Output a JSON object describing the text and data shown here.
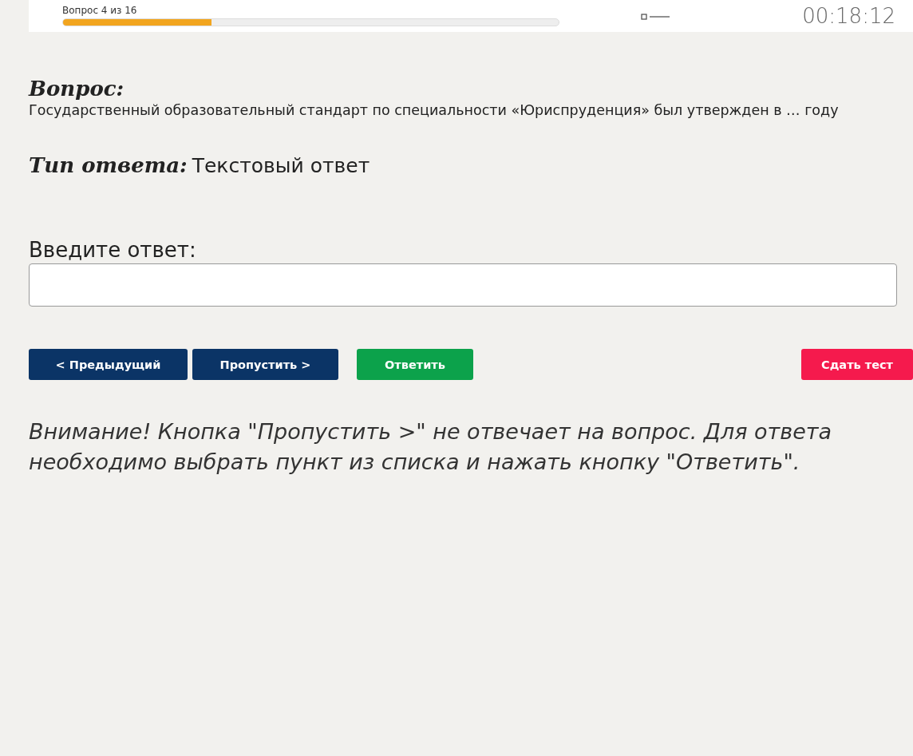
{
  "header": {
    "progress_text": "Вопрос 4 из 16",
    "progress": {
      "level": 0.3
    },
    "timer": "00:18:12"
  },
  "question": {
    "heading": "Вопрос:",
    "text": "Государственный образовательный стандарт по специальности «Юриспруденция» был утвержден в … году"
  },
  "answer_type": {
    "heading": "Тип ответа:",
    "value": "Текстовый ответ"
  },
  "answer": {
    "label": "Введите ответ:"
  },
  "buttons": [
    {
      "label": "< Предыдущий",
      "kind": "nav"
    },
    {
      "label": "Пропустить >",
      "kind": "nav"
    },
    {
      "label": "Ответить",
      "kind": "submit"
    },
    {
      "label": "Сдать тест",
      "kind": "finish"
    }
  ],
  "notice": "Внимание! Кнопка \"Пропустить >\" не отвечает на вопрос. Для ответа необходимо выбрать пункт из списка и нажать кнопку \"Ответить\"."
}
